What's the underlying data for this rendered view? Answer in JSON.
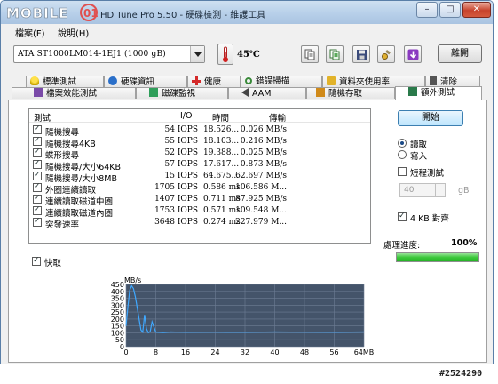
{
  "window": {
    "title": "HD Tune Pro 5.50 - 硬碟檢測 - 維護工具",
    "logo_text": "MOBILE01",
    "controls": [
      "–",
      "□",
      "✕"
    ]
  },
  "menu": {
    "items": [
      "檔案(F)",
      "說明(H)"
    ]
  },
  "toolbar": {
    "drive": "ATA    ST1000LM014-1EJ1 (1000 gB)",
    "temperature": "45℃",
    "exit_label": "離開",
    "buttons": [
      "copy-info-icon",
      "copy-screenshot-icon",
      "save-icon",
      "options-icon",
      "download-icon"
    ]
  },
  "tabs_row1": [
    {
      "label": "標準測試",
      "icon": "bulb-icon",
      "color": "#c8a400"
    },
    {
      "label": "硬碟資訊",
      "icon": "info-icon",
      "color": "#2a6fc9"
    },
    {
      "label": "健康",
      "icon": "health-icon",
      "color": "#d42a2a"
    },
    {
      "label": "錯誤掃描",
      "icon": "magnifier-icon",
      "color": "#3a8a3a"
    },
    {
      "label": "資料夾使用率",
      "icon": "folder-icon",
      "color": "#e2b32a"
    },
    {
      "label": "清除",
      "icon": "trash-icon",
      "color": "#555555"
    }
  ],
  "tabs_row2": [
    {
      "label": "檔案效能測試",
      "icon": "file-perf-icon",
      "color": "#7a4aa8"
    },
    {
      "label": "磁碟監視",
      "icon": "monitor-icon",
      "color": "#2f9e5a"
    },
    {
      "label": "AAM",
      "icon": "speaker-icon",
      "color": "#444444"
    },
    {
      "label": "隨機存取",
      "icon": "random-icon",
      "color": "#d08a1a"
    },
    {
      "label": "額外測試",
      "icon": "extra-icon",
      "color": "#2a7a4a"
    }
  ],
  "results": {
    "columns": [
      "測試",
      "I/O",
      "時間",
      "傳輸"
    ],
    "rows": [
      {
        "name": "隨機搜尋",
        "io": "54 IOPS",
        "time": "18.526...",
        "transfer": "0.026 MB/s"
      },
      {
        "name": "隨機搜尋4KB",
        "io": "55 IOPS",
        "time": "18.103...",
        "transfer": "0.216 MB/s"
      },
      {
        "name": "蝶形搜尋",
        "io": "52 IOPS",
        "time": "19.388...",
        "transfer": "0.025 MB/s"
      },
      {
        "name": "隨機搜尋/大小64KB",
        "io": "57 IOPS",
        "time": "17.617...",
        "transfer": "0.873 MB/s"
      },
      {
        "name": "隨機搜尋/大小8MB",
        "io": "15 IOPS",
        "time": "64.675...",
        "transfer": "62.697 MB/s"
      },
      {
        "name": "外圈連續讀取",
        "io": "1705 IOPS",
        "time": "0.586 ms",
        "transfer": "106.586 M..."
      },
      {
        "name": "連續讀取磁道中圈",
        "io": "1407 IOPS",
        "time": "0.711 ms",
        "transfer": "87.925 MB/s"
      },
      {
        "name": "連續讀取磁道內圈",
        "io": "1753 IOPS",
        "time": "0.571 ms",
        "transfer": "109.548 M..."
      },
      {
        "name": "突發速率",
        "io": "3648 IOPS",
        "time": "0.274 ms",
        "transfer": "227.979 M..."
      }
    ]
  },
  "side": {
    "start_label": "開始",
    "read_label": "讀取",
    "write_label": "寫入",
    "short_test_label": "短程測試",
    "short_value": "40",
    "short_unit": "gB",
    "align_label": "4 KB 對齊",
    "progress_label": "處理進度:",
    "progress_value": "100%",
    "progress_fraction": 1.0
  },
  "cache_label": "快取",
  "chart_data": {
    "type": "line",
    "ylabel": "MB/s",
    "xunit": "MB",
    "ylim": [
      0,
      450
    ],
    "xlim": [
      0,
      64
    ],
    "yticks": [
      0,
      50,
      100,
      150,
      200,
      250,
      300,
      350,
      400,
      450
    ],
    "xticks": [
      0,
      8,
      16,
      24,
      32,
      40,
      48,
      56,
      64
    ],
    "xtick_labels": [
      "0",
      "8",
      "16",
      "24",
      "32",
      "40",
      "48",
      "56",
      "64MB"
    ],
    "grid": true,
    "series": [
      {
        "x": [
          0,
          0.5,
          1,
          1.5,
          2,
          2.5,
          3,
          3.5,
          4,
          4.5,
          5,
          5.5,
          6,
          6.5,
          7,
          8,
          10,
          12,
          16,
          24,
          32,
          40,
          48,
          56,
          64
        ],
        "y": [
          150,
          290,
          410,
          440,
          420,
          360,
          280,
          200,
          120,
          105,
          230,
          130,
          100,
          110,
          180,
          105,
          102,
          106,
          104,
          105,
          104,
          106,
          105,
          104,
          106
        ]
      }
    ]
  },
  "watermark": "#2524290",
  "colors": {
    "progress": "#3cc83c",
    "chart_bg": "#44546a",
    "chart_line": "#3fa8ff",
    "grid": "#6d7d94"
  }
}
